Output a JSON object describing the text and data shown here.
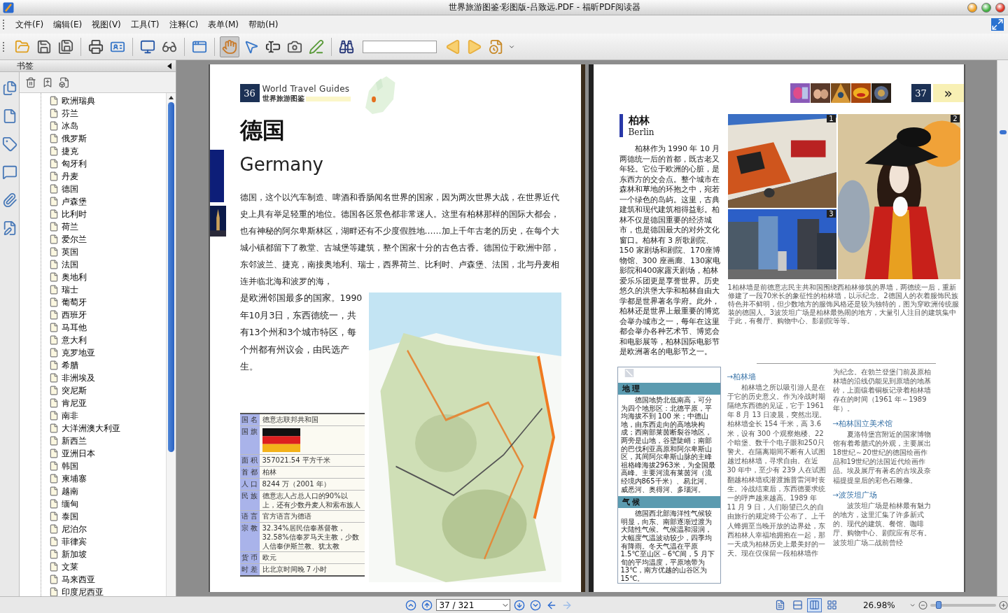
{
  "window": {
    "title": "世界旅游图鉴·彩图版-吕致远.PDF - 福昕PDF阅读器"
  },
  "menu": [
    "文件(F)",
    "编辑(E)",
    "视图(V)",
    "工具(T)",
    "注释(C)",
    "表单(M)",
    "帮助(H)"
  ],
  "toolbar": [
    {
      "kind": "open"
    },
    {
      "kind": "save"
    },
    {
      "kind": "save_all"
    },
    {
      "kind": "separator"
    },
    {
      "kind": "print"
    },
    {
      "kind": "properties"
    },
    {
      "kind": "separator"
    },
    {
      "kind": "fullscreen"
    },
    {
      "kind": "loupe"
    },
    {
      "kind": "separator"
    },
    {
      "kind": "windows"
    },
    {
      "kind": "separator"
    },
    {
      "kind": "hand",
      "selected": true
    },
    {
      "kind": "select",
      "selected": false
    },
    {
      "kind": "text_select",
      "selected": false
    },
    {
      "kind": "snapshot",
      "selected": false
    },
    {
      "kind": "sign"
    },
    {
      "kind": "separator"
    },
    {
      "kind": "find"
    },
    {
      "kind": "search_field"
    },
    {
      "kind": "find_prev"
    },
    {
      "kind": "find_next"
    },
    {
      "kind": "doc_menu"
    }
  ],
  "sidebar": {
    "title": "书签",
    "strip": [
      {
        "kind": "pages"
      },
      {
        "kind": "document"
      },
      {
        "kind": "tag"
      },
      {
        "kind": "comment"
      },
      {
        "kind": "attachment"
      },
      {
        "kind": "edit"
      }
    ],
    "tools": [
      {
        "kind": "delete"
      },
      {
        "kind": "add"
      },
      {
        "kind": "properties"
      }
    ],
    "bookmarks": [
      "欧洲瑞典",
      "芬兰",
      "冰岛",
      "俄罗斯",
      "捷克",
      "匈牙利",
      "丹麦",
      "德国",
      "卢森堡",
      "比利时",
      "荷兰",
      "爱尔兰",
      "英国",
      "法国",
      "奥地利",
      "瑞士",
      "葡萄牙",
      "西班牙",
      "马耳他",
      "意大利",
      "克罗地亚",
      "希腊",
      "非洲埃及",
      "突尼斯",
      "肯尼亚",
      "南非",
      "大洋洲澳大利亚",
      "新西兰",
      "亚洲日本",
      "韩国",
      "柬埔寨",
      "越南",
      "缅甸",
      "泰国",
      "尼泊尔",
      "菲律宾",
      "新加坡",
      "文莱",
      "马来西亚",
      "印度尼西亚"
    ]
  },
  "left_page": {
    "number": "36",
    "series": "World Travel Guides",
    "series_cn": "世界旅游图鉴",
    "title_cn": "德国",
    "title_en": "Germany",
    "intro": [
      "德国，这个以汽车制造、啤酒和香肠闻名世界的国家，因为两次世界大战，在世界近代史上具有举足轻重的地位。德国各区景色都非常迷人。这里有柏林那样的国际大都会，也有神秘的阿尔卑斯林区，湖畔还有不少度假胜地……加上千年古老的历史，在每个大城小镇都留下了教堂、古城堡等建筑，整个国家十分的古色古香。德国位于欧洲中部，东邻波兰、捷克，南接奥地利、瑞士，西界荷兰、比利时、卢森堡、法国，北与丹麦相连并临北海和波罗的海，",
      "是欧洲邻国最多的国家。1990年10月3日，东西德统一，共有13个州和3个城市特区，每个州都有州议会，由民选产生。"
    ],
    "facts": [
      {
        "kind": "text",
        "label": "国 名",
        "value": "德意志联邦共和国"
      },
      {
        "kind": "flag",
        "label": "国 旗"
      },
      {
        "kind": "text",
        "label": "面 积",
        "value": "357021.54 平方千米"
      },
      {
        "kind": "text",
        "label": "首 都",
        "value": "柏林"
      },
      {
        "kind": "text",
        "label": "人 口",
        "value": "8244 万（2001 年）"
      },
      {
        "kind": "text",
        "label": "民 族",
        "value": "德意志人占总人口的90%以上，还有少数丹麦人和索布族人"
      },
      {
        "kind": "text",
        "label": "语 言",
        "value": "官方语言为德语"
      },
      {
        "kind": "text",
        "label": "宗 教",
        "value": "32.34%居民信奉基督教，32.58%信奉罗马天主教，少数人信奉伊斯兰教、犹太教"
      },
      {
        "kind": "text",
        "label": "货 币",
        "value": "欧元"
      },
      {
        "kind": "text",
        "label": "时 差",
        "value": "比北京时间晚 7 小时"
      }
    ]
  },
  "right_page": {
    "number": "37",
    "next": "»",
    "title_cn": "柏林",
    "title_en": "Berlin",
    "intro": "柏林作为 1990 年 10 月两德统一后的首都，既古老又年轻。它位于欧洲的心脏，是东西方的交会点。整个城市在森林和草地的环抱之中，宛若一个绿色的岛屿。这里，古典建筑和现代建筑相得益彰。柏林不仅是德国重要的经济城市，也是德国最大的对外文化窗口。柏林有 3 所歌剧院、150 家剧场和剧院、170座博物馆、300 座画廊、130家电影院和400家露天剧场，柏林爱乐乐团更是享誉世界。历史悠久的洪堡大学和柏林自由大学都是世界著名学府。此外，柏林还是世界上最重要的博览会举办城市之一，每年在这里都会举办各种艺术节、博览会和电影展等，柏林国际电影节是欧洲著名的电影节之一。",
    "photos": [
      {
        "badge": "1"
      },
      {
        "badge": "2"
      },
      {
        "badge": "3"
      }
    ],
    "caption": "1柏林墙是前德意志民主共和国围绕西柏林修筑的界墙，两德统一后，重新修建了一段70米长的象征性的柏林墙，以示纪念。2德国人的衣着服饰民族特色并不鲜明，但少数地方的服饰风格还是较为独特的，图为穿欧洲传统服装的德国人。3波茨坦广场是柏林最热闹的地方，大量引人注目的建筑集中于此，有餐厅、购物中心、影剧院等等。",
    "sidebox": [
      {
        "heading": "地 理",
        "text": "德国地势北低南高，可分为四个地形区：北德平原，平均海拔不到 100 米；中德山地，由东西走向的高地块构成；西南部莱茵断裂谷地区，两旁是山地，谷壁陡峭；南部的巴伐利亚高原和阿尔卑斯山区，其间阿尔卑斯山脉的主峰祖格峰海拔2963米，为全国最高峰。主要河流有莱茵河（流经境内865千米）、易北河、威悉河、奥得河、多瑙河。"
      },
      {
        "heading": "气 候",
        "text": "德国西北部海洋性气候较明显，向东、南部逐渐过渡为大陆性气候。气候温和湿润，大幅度气温波动较少，四季均有降雨。冬天气温在平原 1.5℃至山区－6℃间，5 月下旬的平均温度，平原地带为 13℃，南方优越的山谷区为 15℃。"
      }
    ],
    "columns": [
      [
        {
          "kind": "heading",
          "text": "→柏林墙"
        },
        {
          "kind": "para",
          "text": "柏林墙之所以吸引游人是在于它的历史意义。作为冷战时期隔绝东西德的见证，它于 1961 年 8 月 13 日凌晨，突然出现。柏林墙全长 154 千米，高 3.6 米，设有 300 个观察炮楼、22 个暗堡、数千个电子眼和250只警犬。在隔离期间不断有人试图越过柏林墙，寻求自由。在近 30 年中，至少有 239 人在试图翻越柏林墙或潜渡施普雷河时丧生。冷战结束后，东西德要求统一的呼声越来越高。1989 年 11 月 9 日，人们盼望已久的自由旅行的规定终于公布了。上千人蜂拥至当晚开放的边界处，东西柏林人幸福地拥抱在一起，那一天成为柏林历史上最美好的一天。现在仅保留一段柏林墙作"
        }
      ],
      [
        {
          "kind": "cont",
          "text": "为纪念。在勃兰登堡门前及原柏林墙的沿线仍能见到原墙的地基砖，上面镶着铜板记录着柏林墙存在的时间（1961 年～1989 年）。"
        },
        {
          "kind": "heading",
          "text": "→柏林国立美术馆"
        },
        {
          "kind": "para",
          "text": "夏洛特堡宫附近的国家博物馆有着希腊式的外观，主要展出18世纪～20世纪的德国绘画作品和19世纪的法国近代绘画作品。埃及展厅有著名的古埃及奈福提提皇后的彩色石雕像。"
        },
        {
          "kind": "heading",
          "text": "→波茨坦广场"
        },
        {
          "kind": "para",
          "text": "波茨坦广场是柏林最有魅力的地方，这里汇集了许多新式的、现代的建筑、餐馆、咖啡厅、购物中心、剧院应有尽有。波茨坦广场二战前曾经"
        }
      ]
    ]
  },
  "status": {
    "nav": [
      {
        "kind": "first"
      },
      {
        "kind": "prev"
      }
    ],
    "page": "37 / 321",
    "nav2": [
      {
        "kind": "next"
      },
      {
        "kind": "last"
      }
    ],
    "history": [
      {
        "kind": "back",
        "disabled": false
      },
      {
        "kind": "forward",
        "disabled": true
      }
    ],
    "views": [
      {
        "kind": "single",
        "selected": false
      },
      {
        "kind": "continuous",
        "selected": false
      },
      {
        "kind": "facing",
        "selected": true
      },
      {
        "kind": "facing_continuous",
        "selected": false
      }
    ],
    "zoom": "26.98%",
    "zoom_slider": {
      "level": 0.13
    }
  }
}
